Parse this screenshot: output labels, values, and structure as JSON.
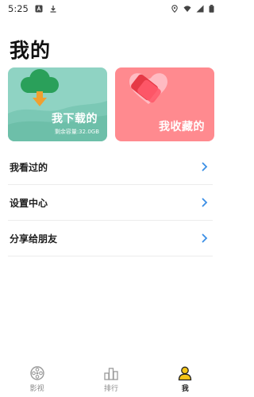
{
  "status_bar": {
    "time": "5:25",
    "left_icons": [
      "app-a-icon",
      "download-status-icon"
    ],
    "right_icons": [
      "location-icon",
      "wifi-icon",
      "signal-icon",
      "battery-icon"
    ]
  },
  "page": {
    "title": "我的"
  },
  "cards": {
    "downloads": {
      "title": "我下载的",
      "storage": "剩余容量:32.0GB",
      "color": "#8fd3c3"
    },
    "favorites": {
      "title": "我收藏的",
      "color": "#ff8a8f"
    }
  },
  "menu": {
    "items": [
      {
        "label": "我看过的"
      },
      {
        "label": "设置中心"
      },
      {
        "label": "分享给朋友"
      }
    ]
  },
  "bottom_nav": {
    "tabs": [
      {
        "label": "影视",
        "icon": "film-reel-icon",
        "active": false
      },
      {
        "label": "排行",
        "icon": "ranking-icon",
        "active": false
      },
      {
        "label": "我",
        "icon": "user-icon",
        "active": true
      }
    ],
    "accent": "#f5c518"
  }
}
